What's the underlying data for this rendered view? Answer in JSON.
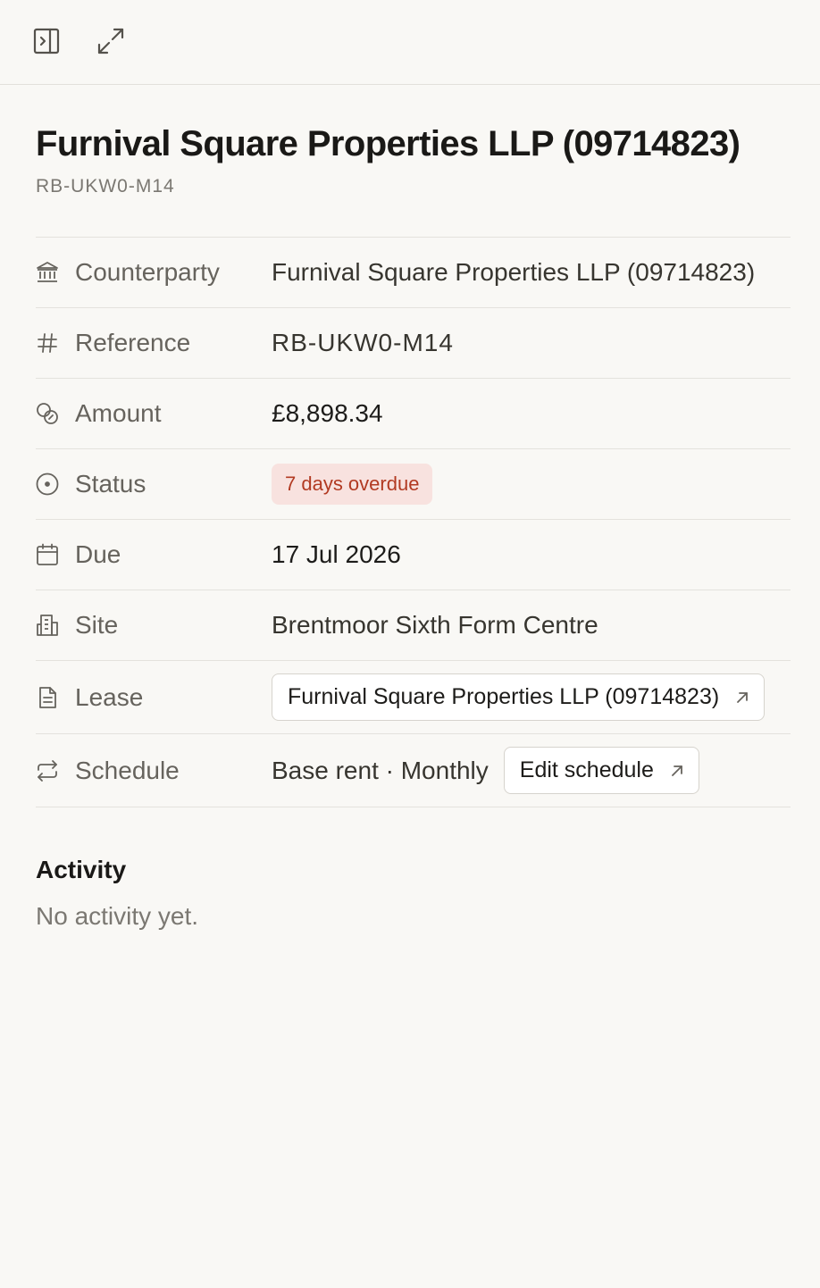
{
  "toolbar": {
    "panel_icon": "sidebar-panel-icon",
    "expand_icon": "expand-arrows-icon"
  },
  "header": {
    "title": "Furnival Square Properties LLP (09714823)",
    "subtitle": "RB-UKW0-M14"
  },
  "properties": {
    "counterparty": {
      "icon": "bank-icon",
      "label": "Counterparty",
      "value": "Furnival Square Properties LLP (09714823)"
    },
    "reference": {
      "icon": "hash-icon",
      "label": "Reference",
      "value": "RB-UKW0-M14"
    },
    "amount": {
      "icon": "coins-icon",
      "label": "Amount",
      "value": "£8,898.34"
    },
    "status": {
      "icon": "circle-dot-icon",
      "label": "Status",
      "value": "7 days overdue",
      "badge_bg": "#f8e2df",
      "badge_fg": "#b23a22"
    },
    "due": {
      "icon": "calendar-icon",
      "label": "Due",
      "value": "17 Jul 2026"
    },
    "site": {
      "icon": "building-icon",
      "label": "Site",
      "value": "Brentmoor Sixth Form Centre"
    },
    "lease": {
      "icon": "document-icon",
      "label": "Lease",
      "link_label": "Furnival Square Properties LLP (09714823)"
    },
    "schedule": {
      "icon": "repeat-icon",
      "label": "Schedule",
      "value": "Base rent · Monthly",
      "button_label": "Edit schedule"
    }
  },
  "activity": {
    "title": "Activity",
    "empty_text": "No activity yet."
  }
}
